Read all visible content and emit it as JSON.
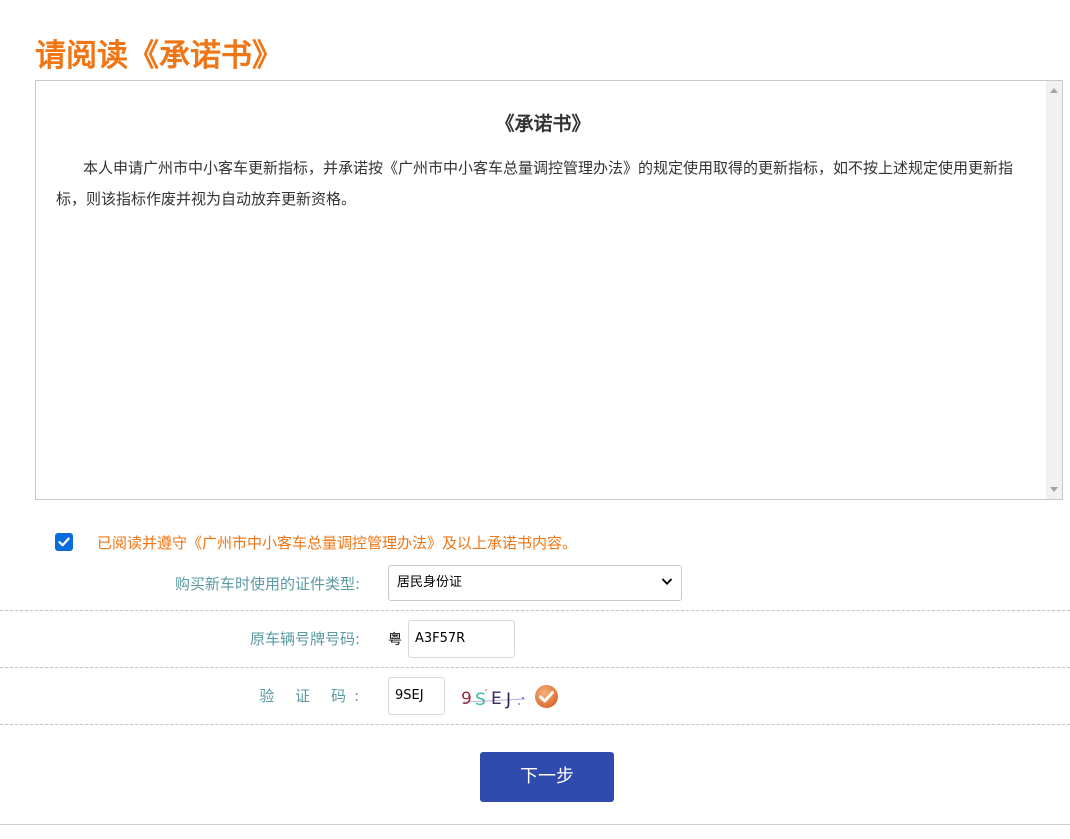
{
  "page": {
    "title": "请阅读《承诺书》"
  },
  "promise": {
    "title": "《承诺书》",
    "body": "本人申请广州市中小客车更新指标，并承诺按《广州市中小客车总量调控管理办法》的规定使用取得的更新指标，如不按上述规定使用更新指标，则该指标作废并视为自动放弃更新资格。"
  },
  "agreement": {
    "checked": true,
    "text": "已阅读并遵守《广州市中小客车总量调控管理办法》及以上承诺书内容。"
  },
  "form": {
    "id_type": {
      "label": "购买新车时使用的证件类型:",
      "selected": "居民身份证"
    },
    "plate": {
      "label": "原车辆号牌号码:",
      "prefix": "粤",
      "value": "A3F57R"
    },
    "captcha": {
      "label": "验 证 码:",
      "value": "9SEJ",
      "image_text": "9SEJ"
    }
  },
  "actions": {
    "next_label": "下一步"
  },
  "colors": {
    "accent_orange": "#f07615",
    "label_teal": "#5a9aa3",
    "button_blue": "#2f4bad",
    "checkbox_blue": "#0a6cdc"
  }
}
